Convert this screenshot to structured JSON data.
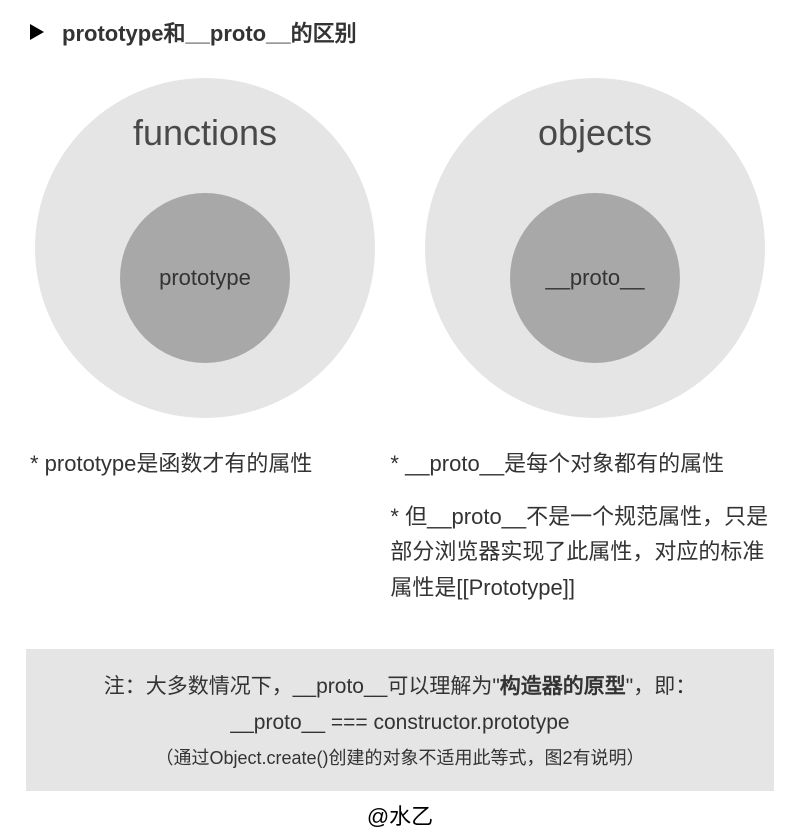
{
  "title": "prototype和__proto__的区别",
  "left": {
    "outer": "functions",
    "inner": "prototype",
    "caption": "* prototype是函数才有的属性"
  },
  "right": {
    "outer": "objects",
    "inner": "__proto__",
    "caption1": "* __proto__是每个对象都有的属性",
    "caption2": "* 但__proto__不是一个规范属性，只是部分浏览器实现了此属性，对应的标准属性是[[Prototype]]"
  },
  "note": {
    "line1_pre": "注：大多数情况下，__proto__可以理解为\"",
    "line1_bold": "构造器的原型",
    "line1_post": "\"，即：",
    "line2": "__proto__ === constructor.prototype",
    "line3": "（通过Object.create()创建的对象不适用此等式，图2有说明）"
  },
  "attribution": "@水乙"
}
